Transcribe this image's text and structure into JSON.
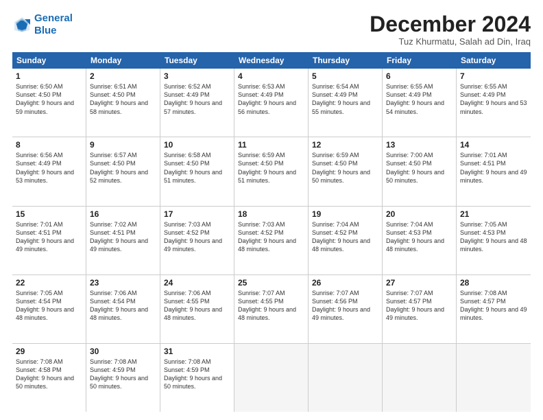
{
  "header": {
    "logo_line1": "General",
    "logo_line2": "Blue",
    "month_title": "December 2024",
    "location": "Tuz Khurmatu, Salah ad Din, Iraq"
  },
  "weekdays": [
    "Sunday",
    "Monday",
    "Tuesday",
    "Wednesday",
    "Thursday",
    "Friday",
    "Saturday"
  ],
  "weeks": [
    [
      {
        "day": "1",
        "sunrise": "Sunrise: 6:50 AM",
        "sunset": "Sunset: 4:50 PM",
        "daylight": "Daylight: 9 hours and 59 minutes."
      },
      {
        "day": "2",
        "sunrise": "Sunrise: 6:51 AM",
        "sunset": "Sunset: 4:50 PM",
        "daylight": "Daylight: 9 hours and 58 minutes."
      },
      {
        "day": "3",
        "sunrise": "Sunrise: 6:52 AM",
        "sunset": "Sunset: 4:49 PM",
        "daylight": "Daylight: 9 hours and 57 minutes."
      },
      {
        "day": "4",
        "sunrise": "Sunrise: 6:53 AM",
        "sunset": "Sunset: 4:49 PM",
        "daylight": "Daylight: 9 hours and 56 minutes."
      },
      {
        "day": "5",
        "sunrise": "Sunrise: 6:54 AM",
        "sunset": "Sunset: 4:49 PM",
        "daylight": "Daylight: 9 hours and 55 minutes."
      },
      {
        "day": "6",
        "sunrise": "Sunrise: 6:55 AM",
        "sunset": "Sunset: 4:49 PM",
        "daylight": "Daylight: 9 hours and 54 minutes."
      },
      {
        "day": "7",
        "sunrise": "Sunrise: 6:55 AM",
        "sunset": "Sunset: 4:49 PM",
        "daylight": "Daylight: 9 hours and 53 minutes."
      }
    ],
    [
      {
        "day": "8",
        "sunrise": "Sunrise: 6:56 AM",
        "sunset": "Sunset: 4:49 PM",
        "daylight": "Daylight: 9 hours and 53 minutes."
      },
      {
        "day": "9",
        "sunrise": "Sunrise: 6:57 AM",
        "sunset": "Sunset: 4:50 PM",
        "daylight": "Daylight: 9 hours and 52 minutes."
      },
      {
        "day": "10",
        "sunrise": "Sunrise: 6:58 AM",
        "sunset": "Sunset: 4:50 PM",
        "daylight": "Daylight: 9 hours and 51 minutes."
      },
      {
        "day": "11",
        "sunrise": "Sunrise: 6:59 AM",
        "sunset": "Sunset: 4:50 PM",
        "daylight": "Daylight: 9 hours and 51 minutes."
      },
      {
        "day": "12",
        "sunrise": "Sunrise: 6:59 AM",
        "sunset": "Sunset: 4:50 PM",
        "daylight": "Daylight: 9 hours and 50 minutes."
      },
      {
        "day": "13",
        "sunrise": "Sunrise: 7:00 AM",
        "sunset": "Sunset: 4:50 PM",
        "daylight": "Daylight: 9 hours and 50 minutes."
      },
      {
        "day": "14",
        "sunrise": "Sunrise: 7:01 AM",
        "sunset": "Sunset: 4:51 PM",
        "daylight": "Daylight: 9 hours and 49 minutes."
      }
    ],
    [
      {
        "day": "15",
        "sunrise": "Sunrise: 7:01 AM",
        "sunset": "Sunset: 4:51 PM",
        "daylight": "Daylight: 9 hours and 49 minutes."
      },
      {
        "day": "16",
        "sunrise": "Sunrise: 7:02 AM",
        "sunset": "Sunset: 4:51 PM",
        "daylight": "Daylight: 9 hours and 49 minutes."
      },
      {
        "day": "17",
        "sunrise": "Sunrise: 7:03 AM",
        "sunset": "Sunset: 4:52 PM",
        "daylight": "Daylight: 9 hours and 49 minutes."
      },
      {
        "day": "18",
        "sunrise": "Sunrise: 7:03 AM",
        "sunset": "Sunset: 4:52 PM",
        "daylight": "Daylight: 9 hours and 48 minutes."
      },
      {
        "day": "19",
        "sunrise": "Sunrise: 7:04 AM",
        "sunset": "Sunset: 4:52 PM",
        "daylight": "Daylight: 9 hours and 48 minutes."
      },
      {
        "day": "20",
        "sunrise": "Sunrise: 7:04 AM",
        "sunset": "Sunset: 4:53 PM",
        "daylight": "Daylight: 9 hours and 48 minutes."
      },
      {
        "day": "21",
        "sunrise": "Sunrise: 7:05 AM",
        "sunset": "Sunset: 4:53 PM",
        "daylight": "Daylight: 9 hours and 48 minutes."
      }
    ],
    [
      {
        "day": "22",
        "sunrise": "Sunrise: 7:05 AM",
        "sunset": "Sunset: 4:54 PM",
        "daylight": "Daylight: 9 hours and 48 minutes."
      },
      {
        "day": "23",
        "sunrise": "Sunrise: 7:06 AM",
        "sunset": "Sunset: 4:54 PM",
        "daylight": "Daylight: 9 hours and 48 minutes."
      },
      {
        "day": "24",
        "sunrise": "Sunrise: 7:06 AM",
        "sunset": "Sunset: 4:55 PM",
        "daylight": "Daylight: 9 hours and 48 minutes."
      },
      {
        "day": "25",
        "sunrise": "Sunrise: 7:07 AM",
        "sunset": "Sunset: 4:55 PM",
        "daylight": "Daylight: 9 hours and 48 minutes."
      },
      {
        "day": "26",
        "sunrise": "Sunrise: 7:07 AM",
        "sunset": "Sunset: 4:56 PM",
        "daylight": "Daylight: 9 hours and 49 minutes."
      },
      {
        "day": "27",
        "sunrise": "Sunrise: 7:07 AM",
        "sunset": "Sunset: 4:57 PM",
        "daylight": "Daylight: 9 hours and 49 minutes."
      },
      {
        "day": "28",
        "sunrise": "Sunrise: 7:08 AM",
        "sunset": "Sunset: 4:57 PM",
        "daylight": "Daylight: 9 hours and 49 minutes."
      }
    ],
    [
      {
        "day": "29",
        "sunrise": "Sunrise: 7:08 AM",
        "sunset": "Sunset: 4:58 PM",
        "daylight": "Daylight: 9 hours and 50 minutes."
      },
      {
        "day": "30",
        "sunrise": "Sunrise: 7:08 AM",
        "sunset": "Sunset: 4:59 PM",
        "daylight": "Daylight: 9 hours and 50 minutes."
      },
      {
        "day": "31",
        "sunrise": "Sunrise: 7:08 AM",
        "sunset": "Sunset: 4:59 PM",
        "daylight": "Daylight: 9 hours and 50 minutes."
      },
      {
        "day": "",
        "sunrise": "",
        "sunset": "",
        "daylight": ""
      },
      {
        "day": "",
        "sunrise": "",
        "sunset": "",
        "daylight": ""
      },
      {
        "day": "",
        "sunrise": "",
        "sunset": "",
        "daylight": ""
      },
      {
        "day": "",
        "sunrise": "",
        "sunset": "",
        "daylight": ""
      }
    ]
  ]
}
